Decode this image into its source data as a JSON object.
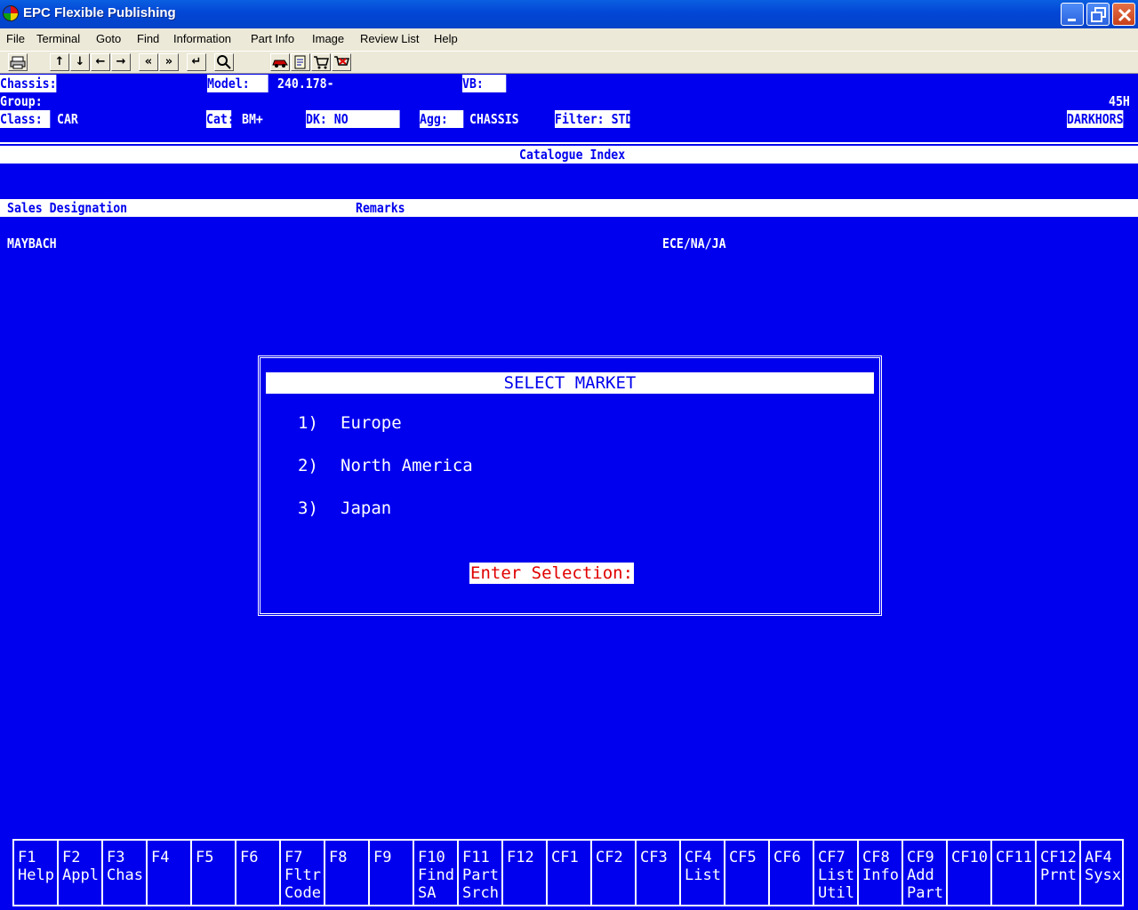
{
  "window": {
    "title": "EPC Flexible Publishing"
  },
  "menu": [
    "File",
    "Terminal",
    "Goto",
    "Find",
    "Information",
    "Part Info",
    "Image",
    "Review List",
    "Help"
  ],
  "toolbar": {
    "icons": [
      "printer-icon",
      "arrow-up-icon",
      "arrow-down-icon",
      "arrow-left-icon",
      "arrow-right-icon",
      "page-back-icon",
      "page-forward-icon",
      "enter-icon",
      "search-icon",
      "car-icon",
      "notepad-icon",
      "cart-icon",
      "cart-remove-icon"
    ]
  },
  "header": {
    "chassis_label": "Chassis:",
    "chassis_value": "",
    "model_label": "Model:",
    "model_value": "240.178-",
    "vb_label": "VB:",
    "vb_value": "",
    "group_label": "Group:",
    "code": "45H",
    "class_label": "Class:",
    "class_value": "CAR",
    "cat_label": "Cat:",
    "cat_value": "BM+",
    "dk_label": "DK: NO",
    "agg_label": "Agg:",
    "agg_value": "CHASSIS",
    "filter_label": "Filter: STD",
    "user": "DARKHORSE"
  },
  "catalogue": {
    "title": "Catalogue Index",
    "columns": [
      "Sales Designation",
      "Remarks"
    ],
    "rows": [
      {
        "designation": "MAYBACH",
        "remarks": "ECE/NA/JA"
      }
    ]
  },
  "dialog": {
    "title": "SELECT MARKET",
    "options": [
      {
        "num": "1)",
        "label": "Europe"
      },
      {
        "num": "2)",
        "label": "North America"
      },
      {
        "num": "3)",
        "label": "Japan"
      }
    ],
    "prompt": "Enter Selection:"
  },
  "function_keys": [
    {
      "key": "F1",
      "label": "Help"
    },
    {
      "key": "F2",
      "label": "Appl"
    },
    {
      "key": "F3",
      "label": "Chas"
    },
    {
      "key": "F4",
      "label": ""
    },
    {
      "key": "F5",
      "label": ""
    },
    {
      "key": "F6",
      "label": ""
    },
    {
      "key": "F7",
      "label": "Fltr\nCode"
    },
    {
      "key": "F8",
      "label": ""
    },
    {
      "key": "F9",
      "label": ""
    },
    {
      "key": "F10",
      "label": "Find\nSA"
    },
    {
      "key": "F11",
      "label": "Part\nSrch"
    },
    {
      "key": "F12",
      "label": ""
    },
    {
      "key": "CF1",
      "label": ""
    },
    {
      "key": "CF2",
      "label": ""
    },
    {
      "key": "CF3",
      "label": ""
    },
    {
      "key": "CF4",
      "label": "List"
    },
    {
      "key": "CF5",
      "label": ""
    },
    {
      "key": "CF6",
      "label": ""
    },
    {
      "key": "CF7",
      "label": "List\nUtil"
    },
    {
      "key": "CF8",
      "label": "Info"
    },
    {
      "key": "CF9",
      "label": "Add\nPart"
    },
    {
      "key": "CF10",
      "label": ""
    },
    {
      "key": "CF11",
      "label": ""
    },
    {
      "key": "CF12",
      "label": "Prnt"
    },
    {
      "key": "AF4",
      "label": "Sysx"
    }
  ],
  "colors": {
    "terminal_bg": "#0000ee",
    "prompt_text": "#e00000"
  }
}
